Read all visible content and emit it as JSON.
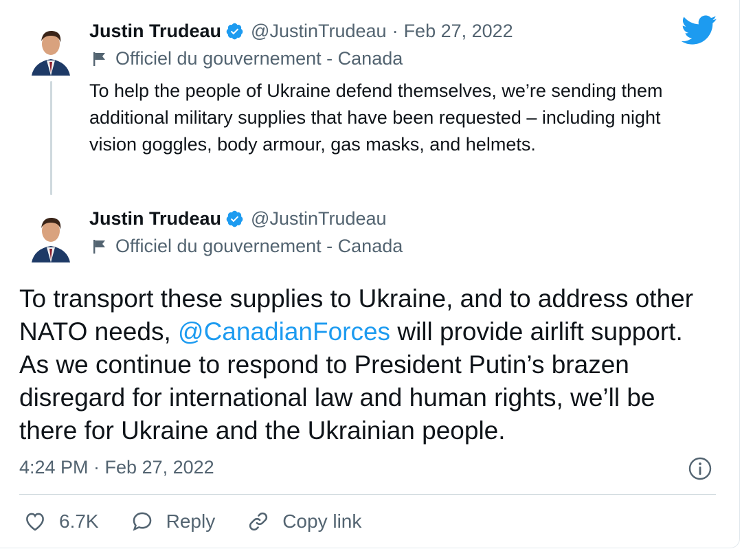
{
  "colors": {
    "accent": "#1d9bf0",
    "text": "#0f1419",
    "secondary": "#536471"
  },
  "quoted_tweet": {
    "author_name": "Justin Trudeau",
    "handle": "@JustinTrudeau",
    "separator": "·",
    "date": "Feb 27, 2022",
    "label": "Officiel du gouvernement - Canada",
    "text": "To help the people of Ukraine defend themselves, we’re sending them additional military supplies that have been requested – including night vision goggles, body armour, gas masks, and helmets."
  },
  "main_tweet": {
    "author_name": "Justin Trudeau",
    "handle": "@JustinTrudeau",
    "label": "Officiel du gouvernement - Canada",
    "text_before_mention": "To transport these supplies to Ukraine, and to address other NATO needs, ",
    "mention": "@CanadianForces",
    "text_after_mention": " will provide airlift support. As we continue to respond to President Putin’s brazen disregard for international law and human rights, we’ll be there for Ukraine and the Ukrainian people.",
    "timestamp": "4:24 PM · Feb 27, 2022"
  },
  "actions": {
    "like_count": "6.7K",
    "reply_label": "Reply",
    "copy_link_label": "Copy link"
  },
  "icons": {
    "brand": "twitter-bird-icon",
    "verified": "verified-badge-icon",
    "flag": "flag-icon",
    "info": "info-icon",
    "like": "heart-icon",
    "reply": "speech-bubble-icon",
    "copy": "link-icon"
  }
}
